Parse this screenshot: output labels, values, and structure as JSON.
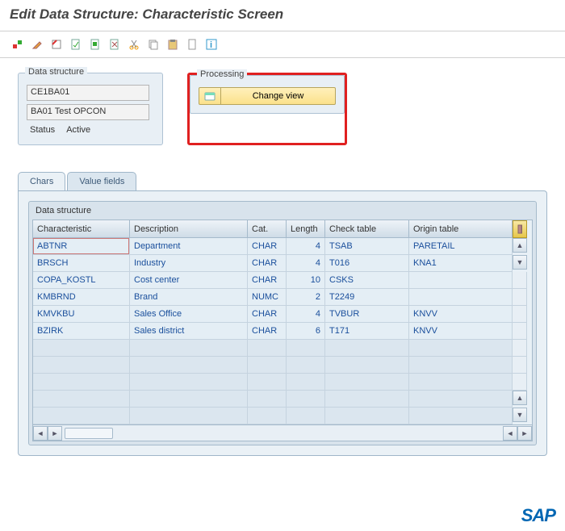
{
  "title": "Edit Data Structure: Characteristic Screen",
  "dataStructure": {
    "label": "Data structure",
    "code": "CE1BA01",
    "desc": "BA01 Test OPCON",
    "statusLabel": "Status",
    "statusValue": "Active"
  },
  "processing": {
    "label": "Processing",
    "button": "Change view"
  },
  "tabs": {
    "chars": "Chars",
    "valueFields": "Value fields"
  },
  "table": {
    "group": "Data structure",
    "headers": {
      "c1": "Characteristic",
      "c2": "Description",
      "c3": "Cat.",
      "c4": "Length",
      "c5": "Check table",
      "c6": "Origin table"
    },
    "rows": [
      {
        "c1": "ABTNR",
        "c2": "Department",
        "c3": "CHAR",
        "c4": "4",
        "c5": "TSAB",
        "c6": "PARETAIL"
      },
      {
        "c1": "BRSCH",
        "c2": "Industry",
        "c3": "CHAR",
        "c4": "4",
        "c5": "T016",
        "c6": "KNA1"
      },
      {
        "c1": "COPA_KOSTL",
        "c2": "Cost center",
        "c3": "CHAR",
        "c4": "10",
        "c5": "CSKS",
        "c6": ""
      },
      {
        "c1": "KMBRND",
        "c2": "Brand",
        "c3": "NUMC",
        "c4": "2",
        "c5": "T2249",
        "c6": ""
      },
      {
        "c1": "KMVKBU",
        "c2": "Sales Office",
        "c3": "CHAR",
        "c4": "4",
        "c5": "TVBUR",
        "c6": "KNVV"
      },
      {
        "c1": "BZIRK",
        "c2": "Sales district",
        "c3": "CHAR",
        "c4": "6",
        "c5": "T171",
        "c6": "KNVV"
      }
    ]
  },
  "logo": "SAP"
}
